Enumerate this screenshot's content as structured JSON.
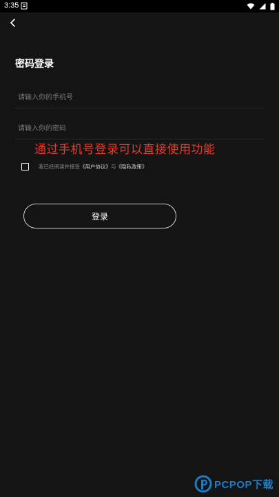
{
  "status_bar": {
    "time": "3:35",
    "icons": [
      "notification-icon",
      "wifi-icon",
      "signal-icon",
      "battery-icon"
    ]
  },
  "header": {
    "back_icon": "chevron-left-icon"
  },
  "page": {
    "title": "密码登录"
  },
  "form": {
    "phone_placeholder": "请输入你的手机号",
    "password_placeholder": "请输入你的密码"
  },
  "overlay_caption": "通过手机号登录可以直接使用功能",
  "agreement": {
    "prefix": "我已经阅读并接受",
    "user_agreement": "《用户协议》",
    "conjunction": "与",
    "privacy_policy": "《隐私政策》"
  },
  "login_button": {
    "label": "登录"
  },
  "watermark": {
    "text": "PCPOP下载"
  },
  "colors": {
    "background": "#141414",
    "overlay_text": "#e53a2c",
    "watermark": "#1e88d8"
  }
}
